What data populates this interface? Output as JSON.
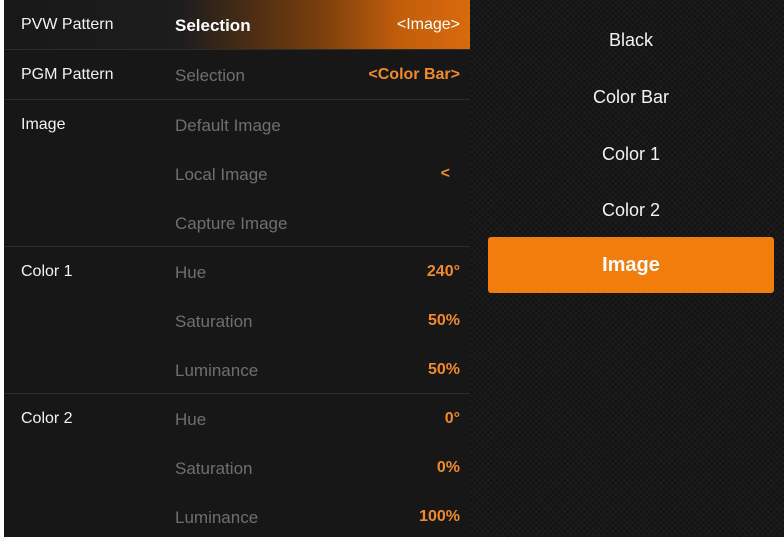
{
  "menu": {
    "rows": [
      {
        "category": "PVW Pattern",
        "item": "Selection",
        "value": "<Image>"
      },
      {
        "category": "PGM Pattern",
        "item": "Selection",
        "value": "<Color Bar>"
      },
      {
        "category": "Image",
        "item": "Default Image",
        "value": ""
      },
      {
        "category": "",
        "item": "Local Image",
        "value": "<"
      },
      {
        "category": "",
        "item": "Capture Image",
        "value": ""
      },
      {
        "category": "Color 1",
        "item": "Hue",
        "value": "240°"
      },
      {
        "category": "",
        "item": "Saturation",
        "value": "50%"
      },
      {
        "category": "",
        "item": "Luminance",
        "value": "50%"
      },
      {
        "category": "Color 2",
        "item": "Hue",
        "value": "0°"
      },
      {
        "category": "",
        "item": "Saturation",
        "value": "0%"
      },
      {
        "category": "",
        "item": "Luminance",
        "value": "100%"
      }
    ]
  },
  "options": {
    "items": [
      "Black",
      "Color Bar",
      "Color 1",
      "Color 2",
      "Image"
    ],
    "selected": "Image"
  },
  "colors": {
    "accent": "#f07d0c",
    "value_text": "#f08a2c",
    "panel_bg": "#171717"
  }
}
